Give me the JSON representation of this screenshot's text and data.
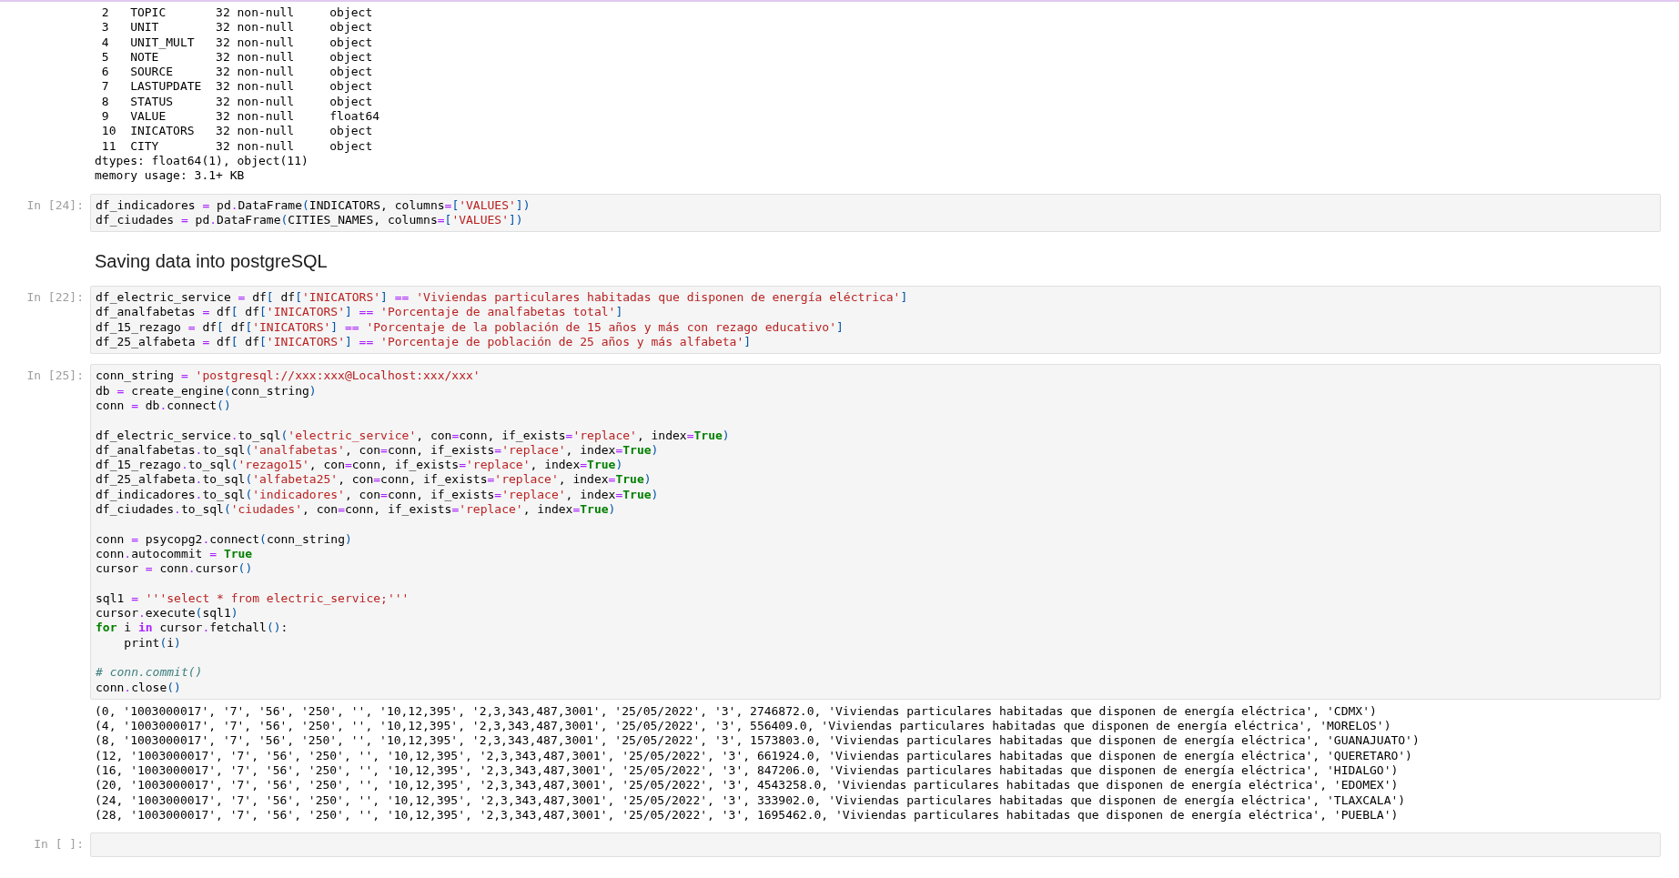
{
  "notebook": {
    "cells": [
      {
        "kind": "output",
        "lines": [
          " 2   TOPIC       32 non-null     object",
          " 3   UNIT        32 non-null     object",
          " 4   UNIT_MULT   32 non-null     object",
          " 5   NOTE        32 non-null     object",
          " 6   SOURCE      32 non-null     object",
          " 7   LASTUPDATE  32 non-null     object",
          " 8   STATUS      32 non-null     object",
          " 9   VALUE       32 non-null     float64",
          " 10  INICATORS   32 non-null     object",
          " 11  CITY        32 non-null     object",
          "dtypes: float64(1), object(11)",
          "memory usage: 3.1+ KB"
        ]
      },
      {
        "kind": "code",
        "prompt": "In [24]:",
        "blocks": [
          {
            "lines": [
              [
                {
                  "text": "df_indicadores ",
                  "kind": "plain"
                },
                {
                  "text": "=",
                  "kind": "op"
                },
                {
                  "text": " pd",
                  "kind": "plain"
                },
                {
                  "text": ".",
                  "kind": "op"
                },
                {
                  "text": "DataFrame",
                  "kind": "plain"
                },
                {
                  "text": "(",
                  "kind": "punct"
                },
                {
                  "text": "INDICATORS, columns",
                  "kind": "plain"
                },
                {
                  "text": "=",
                  "kind": "op"
                },
                {
                  "text": "[",
                  "kind": "punct"
                },
                {
                  "text": "'VALUES'",
                  "kind": "str"
                },
                {
                  "text": "])",
                  "kind": "punct"
                }
              ],
              [
                {
                  "text": "df_ciudades ",
                  "kind": "plain"
                },
                {
                  "text": "=",
                  "kind": "op"
                },
                {
                  "text": " pd",
                  "kind": "plain"
                },
                {
                  "text": ".",
                  "kind": "op"
                },
                {
                  "text": "DataFrame",
                  "kind": "plain"
                },
                {
                  "text": "(",
                  "kind": "punct"
                },
                {
                  "text": "CITIES_NAMES, columns",
                  "kind": "plain"
                },
                {
                  "text": "=",
                  "kind": "op"
                },
                {
                  "text": "[",
                  "kind": "punct"
                },
                {
                  "text": "'VALUES'",
                  "kind": "str"
                },
                {
                  "text": "])",
                  "kind": "punct"
                }
              ]
            ]
          }
        ]
      },
      {
        "kind": "markdown",
        "heading": "Saving data into postgreSQL"
      },
      {
        "kind": "code",
        "prompt": "In [22]:",
        "blocks": [
          {
            "lines": [
              [
                {
                  "text": "df_electric_service ",
                  "kind": "plain"
                },
                {
                  "text": "=",
                  "kind": "op"
                },
                {
                  "text": " df",
                  "kind": "plain"
                },
                {
                  "text": "[",
                  "kind": "punct"
                },
                {
                  "text": " df",
                  "kind": "plain"
                },
                {
                  "text": "[",
                  "kind": "punct"
                },
                {
                  "text": "'INICATORS'",
                  "kind": "str"
                },
                {
                  "text": "]",
                  "kind": "punct"
                },
                {
                  "text": " == ",
                  "kind": "op"
                },
                {
                  "text": "'Viviendas particulares habitadas que disponen de energía eléctrica'",
                  "kind": "str"
                },
                {
                  "text": "]",
                  "kind": "punct"
                }
              ],
              [
                {
                  "text": "df_analfabetas ",
                  "kind": "plain"
                },
                {
                  "text": "=",
                  "kind": "op"
                },
                {
                  "text": " df",
                  "kind": "plain"
                },
                {
                  "text": "[",
                  "kind": "punct"
                },
                {
                  "text": " df",
                  "kind": "plain"
                },
                {
                  "text": "[",
                  "kind": "punct"
                },
                {
                  "text": "'INICATORS'",
                  "kind": "str"
                },
                {
                  "text": "]",
                  "kind": "punct"
                },
                {
                  "text": " == ",
                  "kind": "op"
                },
                {
                  "text": "'Porcentaje de analfabetas total'",
                  "kind": "str"
                },
                {
                  "text": "]",
                  "kind": "punct"
                }
              ],
              [
                {
                  "text": "df_15_rezago ",
                  "kind": "plain"
                },
                {
                  "text": "=",
                  "kind": "op"
                },
                {
                  "text": " df",
                  "kind": "plain"
                },
                {
                  "text": "[",
                  "kind": "punct"
                },
                {
                  "text": " df",
                  "kind": "plain"
                },
                {
                  "text": "[",
                  "kind": "punct"
                },
                {
                  "text": "'INICATORS'",
                  "kind": "str"
                },
                {
                  "text": "]",
                  "kind": "punct"
                },
                {
                  "text": " == ",
                  "kind": "op"
                },
                {
                  "text": "'Porcentaje de la población de 15 años y más con rezago educativo'",
                  "kind": "str"
                },
                {
                  "text": "]",
                  "kind": "punct"
                }
              ],
              [
                {
                  "text": "df_25_alfabeta ",
                  "kind": "plain"
                },
                {
                  "text": "=",
                  "kind": "op"
                },
                {
                  "text": " df",
                  "kind": "plain"
                },
                {
                  "text": "[",
                  "kind": "punct"
                },
                {
                  "text": " df",
                  "kind": "plain"
                },
                {
                  "text": "[",
                  "kind": "punct"
                },
                {
                  "text": "'INICATORS'",
                  "kind": "str"
                },
                {
                  "text": "]",
                  "kind": "punct"
                },
                {
                  "text": " == ",
                  "kind": "op"
                },
                {
                  "text": "'Porcentaje de población de 25 años y más alfabeta'",
                  "kind": "str"
                },
                {
                  "text": "]",
                  "kind": "punct"
                }
              ]
            ]
          }
        ]
      },
      {
        "kind": "code",
        "prompt": "In [25]:",
        "blocks": [
          {
            "lines": [
              [
                {
                  "text": "conn_string ",
                  "kind": "plain"
                },
                {
                  "text": "=",
                  "kind": "op"
                },
                {
                  "text": " 'postgresql://xxx:xxx@Localhost:xxx/xxx'",
                  "kind": "str"
                }
              ],
              [
                {
                  "text": "db ",
                  "kind": "plain"
                },
                {
                  "text": "=",
                  "kind": "op"
                },
                {
                  "text": " create_engine",
                  "kind": "plain"
                },
                {
                  "text": "(",
                  "kind": "punct"
                },
                {
                  "text": "conn_string",
                  "kind": "plain"
                },
                {
                  "text": ")",
                  "kind": "punct"
                }
              ],
              [
                {
                  "text": "conn ",
                  "kind": "plain"
                },
                {
                  "text": "=",
                  "kind": "op"
                },
                {
                  "text": " db",
                  "kind": "plain"
                },
                {
                  "text": ".",
                  "kind": "op"
                },
                {
                  "text": "connect",
                  "kind": "plain"
                },
                {
                  "text": "()",
                  "kind": "punct"
                }
              ]
            ]
          },
          {
            "lines": [
              [
                {
                  "text": "df_electric_service",
                  "kind": "plain"
                },
                {
                  "text": ".",
                  "kind": "op"
                },
                {
                  "text": "to_sql",
                  "kind": "plain"
                },
                {
                  "text": "(",
                  "kind": "punct"
                },
                {
                  "text": "'electric_service'",
                  "kind": "str"
                },
                {
                  "text": ", con",
                  "kind": "plain"
                },
                {
                  "text": "=",
                  "kind": "op"
                },
                {
                  "text": "conn, if_exists",
                  "kind": "plain"
                },
                {
                  "text": "=",
                  "kind": "op"
                },
                {
                  "text": "'replace'",
                  "kind": "str"
                },
                {
                  "text": ", index",
                  "kind": "plain"
                },
                {
                  "text": "=",
                  "kind": "op"
                },
                {
                  "text": "True",
                  "kind": "kw"
                },
                {
                  "text": ")",
                  "kind": "punct"
                }
              ],
              [
                {
                  "text": "df_analfabetas",
                  "kind": "plain"
                },
                {
                  "text": ".",
                  "kind": "op"
                },
                {
                  "text": "to_sql",
                  "kind": "plain"
                },
                {
                  "text": "(",
                  "kind": "punct"
                },
                {
                  "text": "'analfabetas'",
                  "kind": "str"
                },
                {
                  "text": ", con",
                  "kind": "plain"
                },
                {
                  "text": "=",
                  "kind": "op"
                },
                {
                  "text": "conn, if_exists",
                  "kind": "plain"
                },
                {
                  "text": "=",
                  "kind": "op"
                },
                {
                  "text": "'replace'",
                  "kind": "str"
                },
                {
                  "text": ", index",
                  "kind": "plain"
                },
                {
                  "text": "=",
                  "kind": "op"
                },
                {
                  "text": "True",
                  "kind": "kw"
                },
                {
                  "text": ")",
                  "kind": "punct"
                }
              ],
              [
                {
                  "text": "df_15_rezago",
                  "kind": "plain"
                },
                {
                  "text": ".",
                  "kind": "op"
                },
                {
                  "text": "to_sql",
                  "kind": "plain"
                },
                {
                  "text": "(",
                  "kind": "punct"
                },
                {
                  "text": "'rezago15'",
                  "kind": "str"
                },
                {
                  "text": ", con",
                  "kind": "plain"
                },
                {
                  "text": "=",
                  "kind": "op"
                },
                {
                  "text": "conn, if_exists",
                  "kind": "plain"
                },
                {
                  "text": "=",
                  "kind": "op"
                },
                {
                  "text": "'replace'",
                  "kind": "str"
                },
                {
                  "text": ", index",
                  "kind": "plain"
                },
                {
                  "text": "=",
                  "kind": "op"
                },
                {
                  "text": "True",
                  "kind": "kw"
                },
                {
                  "text": ")",
                  "kind": "punct"
                }
              ],
              [
                {
                  "text": "df_25_alfabeta",
                  "kind": "plain"
                },
                {
                  "text": ".",
                  "kind": "op"
                },
                {
                  "text": "to_sql",
                  "kind": "plain"
                },
                {
                  "text": "(",
                  "kind": "punct"
                },
                {
                  "text": "'alfabeta25'",
                  "kind": "str"
                },
                {
                  "text": ", con",
                  "kind": "plain"
                },
                {
                  "text": "=",
                  "kind": "op"
                },
                {
                  "text": "conn, if_exists",
                  "kind": "plain"
                },
                {
                  "text": "=",
                  "kind": "op"
                },
                {
                  "text": "'replace'",
                  "kind": "str"
                },
                {
                  "text": ", index",
                  "kind": "plain"
                },
                {
                  "text": "=",
                  "kind": "op"
                },
                {
                  "text": "True",
                  "kind": "kw"
                },
                {
                  "text": ")",
                  "kind": "punct"
                }
              ],
              [
                {
                  "text": "df_indicadores",
                  "kind": "plain"
                },
                {
                  "text": ".",
                  "kind": "op"
                },
                {
                  "text": "to_sql",
                  "kind": "plain"
                },
                {
                  "text": "(",
                  "kind": "punct"
                },
                {
                  "text": "'indicadores'",
                  "kind": "str"
                },
                {
                  "text": ", con",
                  "kind": "plain"
                },
                {
                  "text": "=",
                  "kind": "op"
                },
                {
                  "text": "conn, if_exists",
                  "kind": "plain"
                },
                {
                  "text": "=",
                  "kind": "op"
                },
                {
                  "text": "'replace'",
                  "kind": "str"
                },
                {
                  "text": ", index",
                  "kind": "plain"
                },
                {
                  "text": "=",
                  "kind": "op"
                },
                {
                  "text": "True",
                  "kind": "kw"
                },
                {
                  "text": ")",
                  "kind": "punct"
                }
              ],
              [
                {
                  "text": "df_ciudades",
                  "kind": "plain"
                },
                {
                  "text": ".",
                  "kind": "op"
                },
                {
                  "text": "to_sql",
                  "kind": "plain"
                },
                {
                  "text": "(",
                  "kind": "punct"
                },
                {
                  "text": "'ciudades'",
                  "kind": "str"
                },
                {
                  "text": ", con",
                  "kind": "plain"
                },
                {
                  "text": "=",
                  "kind": "op"
                },
                {
                  "text": "conn, if_exists",
                  "kind": "plain"
                },
                {
                  "text": "=",
                  "kind": "op"
                },
                {
                  "text": "'replace'",
                  "kind": "str"
                },
                {
                  "text": ", index",
                  "kind": "plain"
                },
                {
                  "text": "=",
                  "kind": "op"
                },
                {
                  "text": "True",
                  "kind": "kw"
                },
                {
                  "text": ")",
                  "kind": "punct"
                }
              ]
            ]
          },
          {
            "lines": [
              [
                {
                  "text": "conn ",
                  "kind": "plain"
                },
                {
                  "text": "=",
                  "kind": "op"
                },
                {
                  "text": " psycopg2",
                  "kind": "plain"
                },
                {
                  "text": ".",
                  "kind": "op"
                },
                {
                  "text": "connect",
                  "kind": "plain"
                },
                {
                  "text": "(",
                  "kind": "punct"
                },
                {
                  "text": "conn_string",
                  "kind": "plain"
                },
                {
                  "text": ")",
                  "kind": "punct"
                }
              ],
              [
                {
                  "text": "conn",
                  "kind": "plain"
                },
                {
                  "text": ".",
                  "kind": "op"
                },
                {
                  "text": "autocommit ",
                  "kind": "plain"
                },
                {
                  "text": "=",
                  "kind": "op"
                },
                {
                  "text": " True",
                  "kind": "kw"
                }
              ],
              [
                {
                  "text": "cursor ",
                  "kind": "plain"
                },
                {
                  "text": "=",
                  "kind": "op"
                },
                {
                  "text": " conn",
                  "kind": "plain"
                },
                {
                  "text": ".",
                  "kind": "op"
                },
                {
                  "text": "cursor",
                  "kind": "plain"
                },
                {
                  "text": "()",
                  "kind": "punct"
                }
              ]
            ]
          },
          {
            "lines": [
              [
                {
                  "text": "sql1 ",
                  "kind": "plain"
                },
                {
                  "text": "=",
                  "kind": "op"
                },
                {
                  "text": " '''select * from electric_service;'''",
                  "kind": "str"
                }
              ],
              [
                {
                  "text": "cursor",
                  "kind": "plain"
                },
                {
                  "text": ".",
                  "kind": "op"
                },
                {
                  "text": "execute",
                  "kind": "plain"
                },
                {
                  "text": "(",
                  "kind": "punct"
                },
                {
                  "text": "sql1",
                  "kind": "plain"
                },
                {
                  "text": ")",
                  "kind": "punct"
                }
              ],
              [
                {
                  "text": "for",
                  "kind": "kw"
                },
                {
                  "text": " i ",
                  "kind": "plain"
                },
                {
                  "text": "in",
                  "kind": "opkw"
                },
                {
                  "text": " cursor",
                  "kind": "plain"
                },
                {
                  "text": ".",
                  "kind": "op"
                },
                {
                  "text": "fetchall",
                  "kind": "plain"
                },
                {
                  "text": "()",
                  "kind": "punct"
                },
                {
                  "text": ":",
                  "kind": "plain"
                }
              ],
              [
                {
                  "text": "    print",
                  "kind": "plain"
                },
                {
                  "text": "(",
                  "kind": "punct"
                },
                {
                  "text": "i",
                  "kind": "plain"
                },
                {
                  "text": ")",
                  "kind": "punct"
                }
              ]
            ]
          },
          {
            "lines": [
              [
                {
                  "text": "# conn.commit()",
                  "kind": "comment"
                }
              ],
              [
                {
                  "text": "conn",
                  "kind": "plain"
                },
                {
                  "text": ".",
                  "kind": "op"
                },
                {
                  "text": "close",
                  "kind": "plain"
                },
                {
                  "text": "()",
                  "kind": "punct"
                }
              ]
            ]
          }
        ],
        "output": [
          "(0, '1003000017', '7', '56', '250', '', '10,12,395', '2,3,343,487,3001', '25/05/2022', '3', 2746872.0, 'Viviendas particulares habitadas que disponen de energía eléctrica', 'CDMX')",
          "(4, '1003000017', '7', '56', '250', '', '10,12,395', '2,3,343,487,3001', '25/05/2022', '3', 556409.0, 'Viviendas particulares habitadas que disponen de energía eléctrica', 'MORELOS')",
          "(8, '1003000017', '7', '56', '250', '', '10,12,395', '2,3,343,487,3001', '25/05/2022', '3', 1573803.0, 'Viviendas particulares habitadas que disponen de energía eléctrica', 'GUANAJUATO')",
          "(12, '1003000017', '7', '56', '250', '', '10,12,395', '2,3,343,487,3001', '25/05/2022', '3', 661924.0, 'Viviendas particulares habitadas que disponen de energía eléctrica', 'QUERETARO')",
          "(16, '1003000017', '7', '56', '250', '', '10,12,395', '2,3,343,487,3001', '25/05/2022', '3', 847206.0, 'Viviendas particulares habitadas que disponen de energía eléctrica', 'HIDALGO')",
          "(20, '1003000017', '7', '56', '250', '', '10,12,395', '2,3,343,487,3001', '25/05/2022', '3', 4543258.0, 'Viviendas particulares habitadas que disponen de energía eléctrica', 'EDOMEX')",
          "(24, '1003000017', '7', '56', '250', '', '10,12,395', '2,3,343,487,3001', '25/05/2022', '3', 333902.0, 'Viviendas particulares habitadas que disponen de energía eléctrica', 'TLAXCALA')",
          "(28, '1003000017', '7', '56', '250', '', '10,12,395', '2,3,343,487,3001', '25/05/2022', '3', 1695462.0, 'Viviendas particulares habitadas que disponen de energía eléctrica', 'PUEBLA')"
        ]
      },
      {
        "kind": "code",
        "prompt": "In [ ]:"
      }
    ]
  }
}
